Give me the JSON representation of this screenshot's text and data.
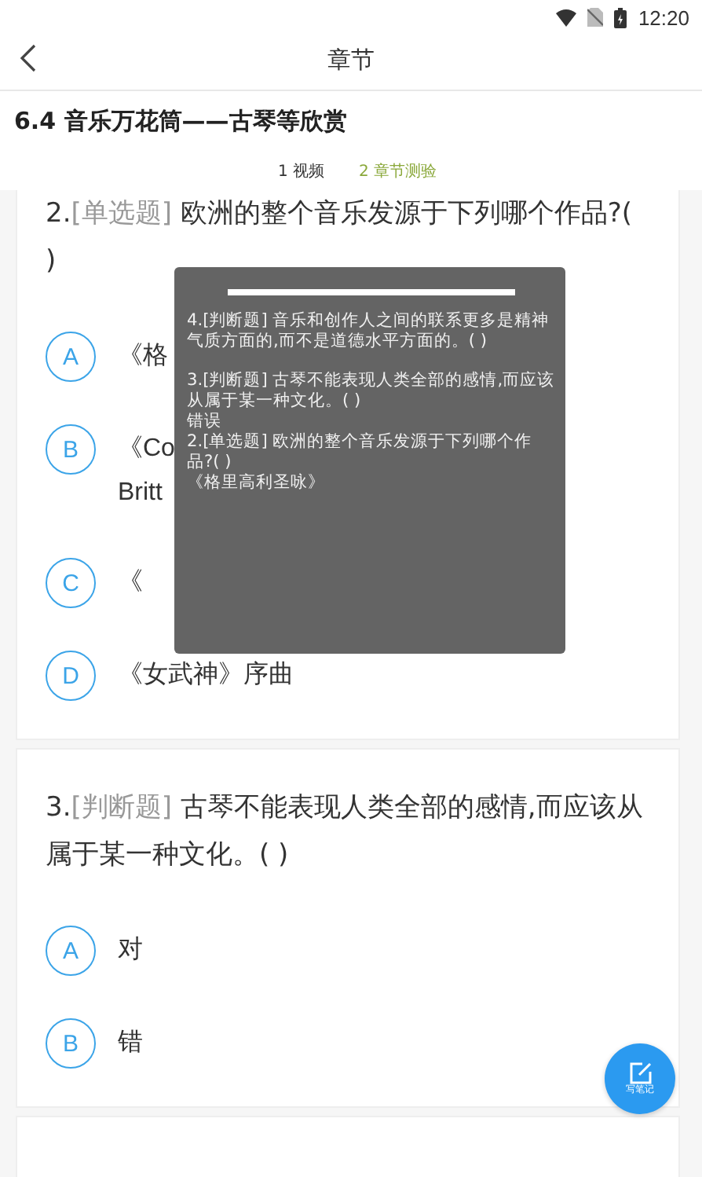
{
  "status_bar": {
    "time": "12:20"
  },
  "header": {
    "title": "章节"
  },
  "course_title": "6.4 音乐万花筒——古琴等欣赏",
  "tabs": [
    {
      "label": "1 视频",
      "selected": false
    },
    {
      "label": "2 章节测验",
      "selected": true
    }
  ],
  "questions": [
    {
      "number": "2.",
      "type": "[单选题]",
      "text": "欧洲的整个音乐发源于下列哪个作品?( )",
      "options": [
        {
          "letter": "A",
          "lines": [
            "《格"
          ]
        },
        {
          "letter": "B",
          "lines": [
            "《Co",
            "Britt"
          ]
        },
        {
          "letter": "C",
          "lines": [
            "《"
          ]
        },
        {
          "letter": "D",
          "lines": [
            "《女武神》序曲"
          ]
        }
      ]
    },
    {
      "number": "3.",
      "type": "[判断题]",
      "text": "古琴不能表现人类全部的感情,而应该从属于某一种文化。( )",
      "options": [
        {
          "letter": "A",
          "lines": [
            "对"
          ]
        },
        {
          "letter": "B",
          "lines": [
            "错"
          ]
        }
      ]
    }
  ],
  "popup": {
    "entries": [
      {
        "text": "4.[判断题] 音乐和创作人之间的联系更多是精神气质方面的,而不是道德水平方面的。( )"
      },
      {
        "text": "3.[判断题] 古琴不能表现人类全部的感情,而应该从属于某一种文化。( )",
        "answer": "错误"
      },
      {
        "text": "2.[单选题] 欧洲的整个音乐发源于下列哪个作品?( )",
        "answer": "《格里高利圣咏》"
      }
    ]
  },
  "note_button": {
    "label": "写笔记"
  }
}
